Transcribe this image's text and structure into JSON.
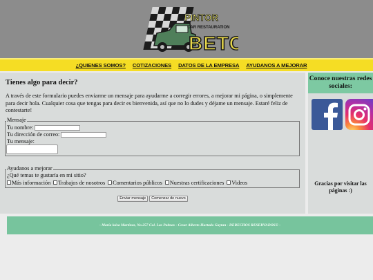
{
  "brand": {
    "logo_text_top": "PINTOR",
    "logo_text_mid": "CAR RESTAURATION",
    "logo_text_big": "BETO"
  },
  "nav": {
    "items": [
      "¿QUIENES SOMOS?",
      "COTIZACIONES",
      "DATOS DE LA EMPRESA",
      "AYUDANOS A MEJORAR"
    ]
  },
  "main": {
    "title": "Tienes algo para decir?",
    "intro": "A través de este formulario puedes enviarme un mensaje para ayudarme a corregir errores, a mejorar mi página, o simplemente para decir hola. Cualquier cosa que tengas para decir es bienvenida, así que no lo dudes y déjame un mensaje. Estaré feliz de contestarte!"
  },
  "form": {
    "legend": "Mensaje",
    "name_label": "Tu nombre:",
    "name_value": "",
    "email_label": "Tu dirección de correo:",
    "email_value": "",
    "message_label": "Tu mensaje:",
    "message_value": ""
  },
  "survey": {
    "legend": "Ayudanos a mejorar",
    "question": "¿Qué temas te gustaría en mi sitio?",
    "options": [
      "Más información",
      "Trabajos de nosotros",
      "Comentarios públicos",
      "Nuestras certificaciones",
      "Videos"
    ]
  },
  "buttons": {
    "submit": "Enviar mensaje",
    "reset": "Comenzar de nuevo"
  },
  "sidebar": {
    "heading": "Conoce nuestras redes sociales:",
    "facebook_icon": "facebook-icon",
    "instagram_icon": "instagram-icon",
    "thanks": "Gracias por visitar las páginas :)"
  },
  "footer": {
    "text": "- María luisa Martínez, No.257 Col. Las Palmas - Cesar Alberto Hurtado Gaytan - DERECHOS RESERVADOS© -"
  },
  "colors": {
    "header_bg": "#8c8c8c",
    "nav_bg": "#f5dd24",
    "panel_bg": "#d9dcdb",
    "accent_green": "#77c49d",
    "facebook_blue": "#3b5998"
  }
}
